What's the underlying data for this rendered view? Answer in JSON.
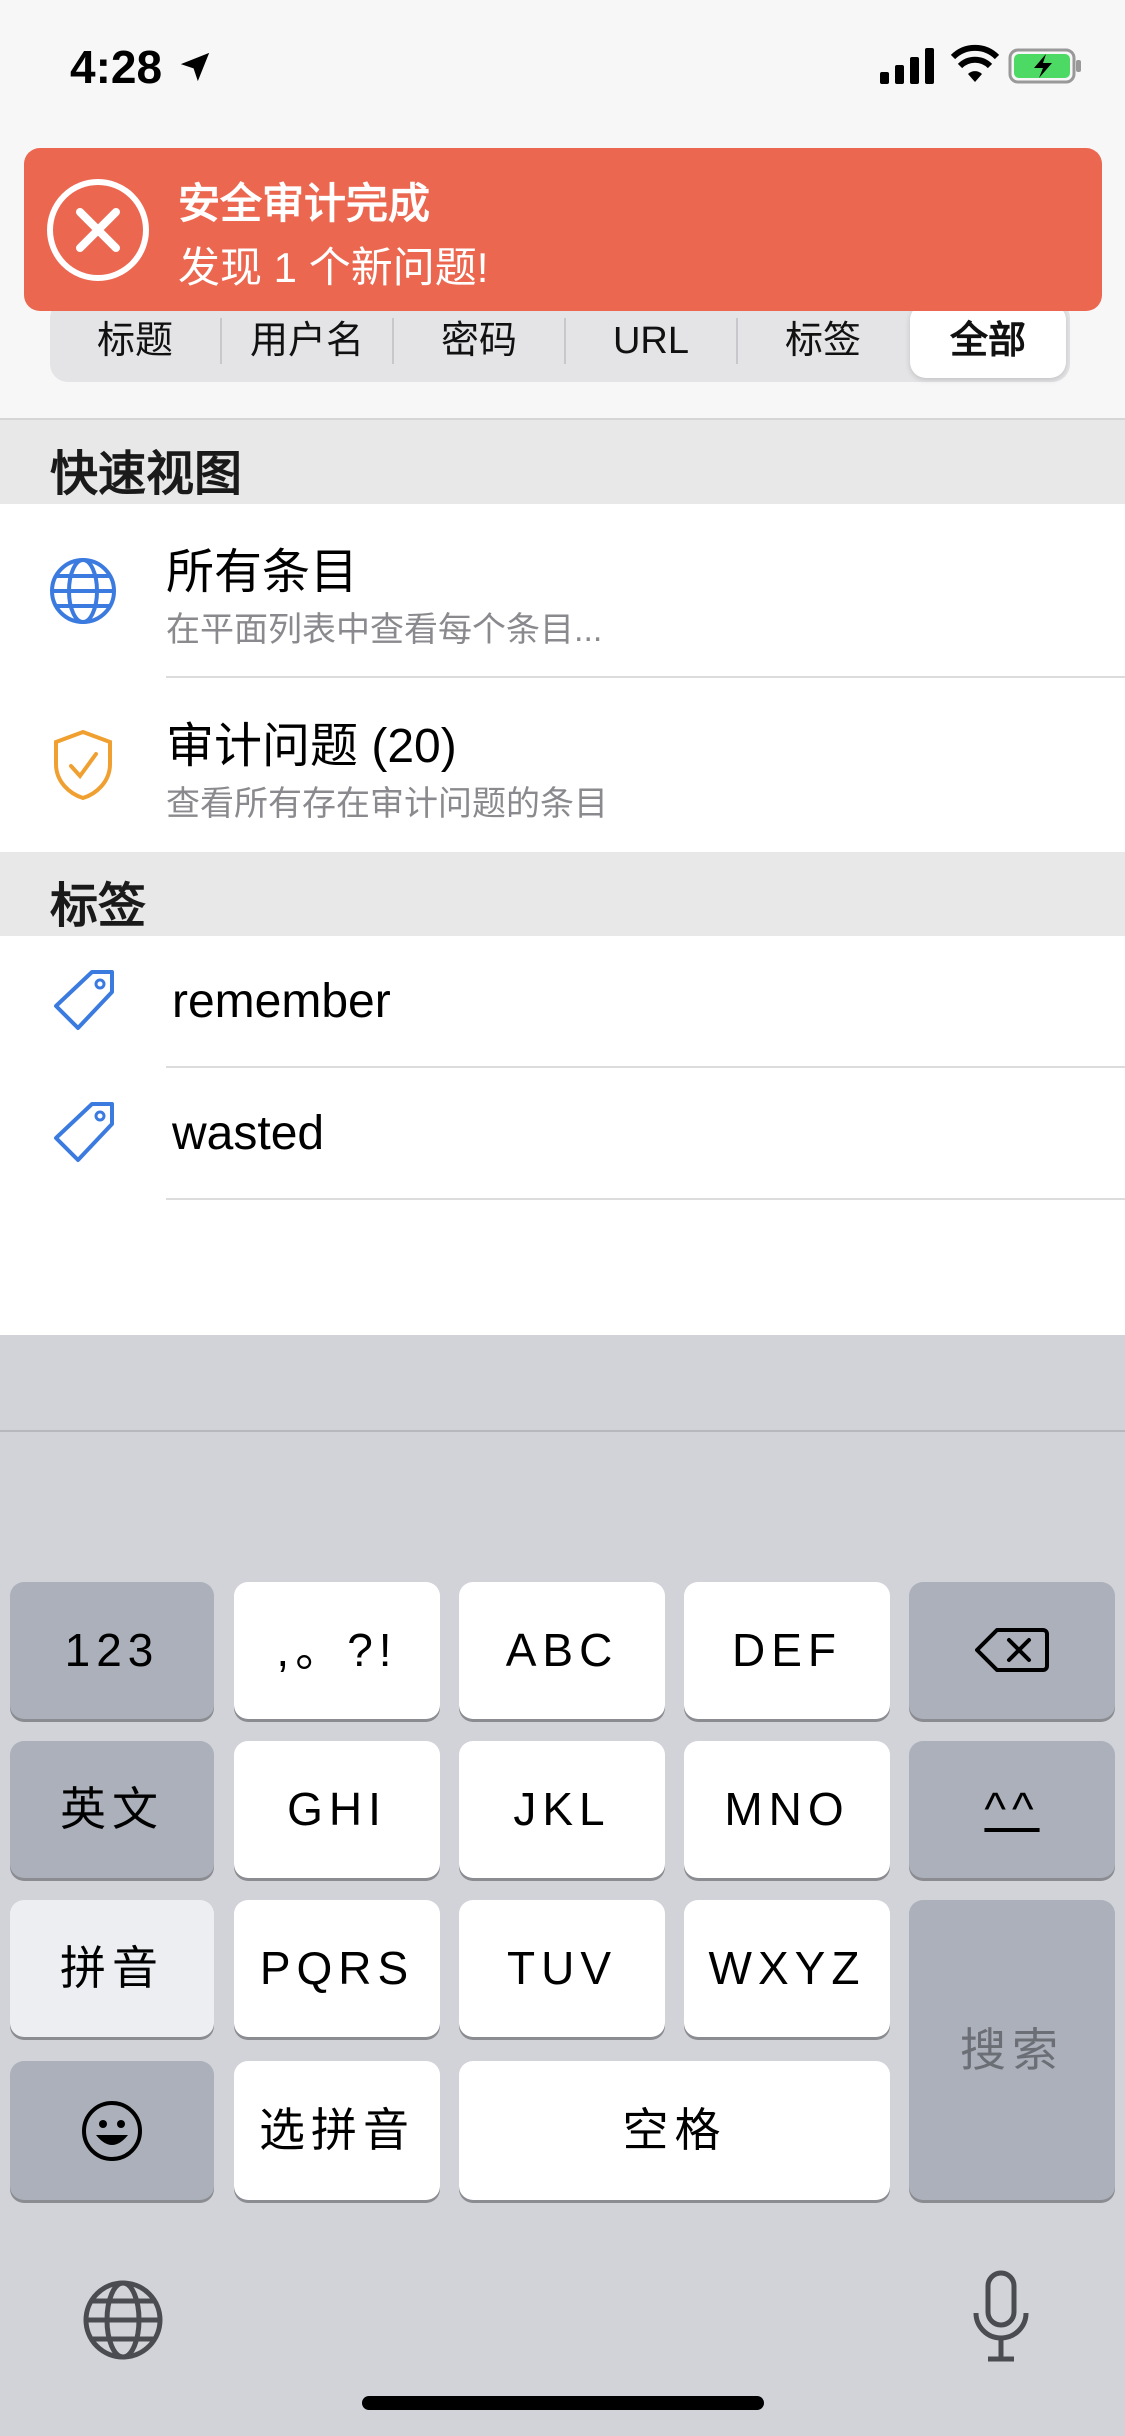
{
  "status_bar": {
    "time": "4:28"
  },
  "banner": {
    "title": "安全审计完成",
    "message": "发现 1 个新问题!"
  },
  "search_scope": {
    "options": [
      "标题",
      "用户名",
      "密码",
      "URL",
      "标签",
      "全部"
    ],
    "selected": "全部"
  },
  "quick_views": {
    "header": "快速视图",
    "items": [
      {
        "title": "所有条目",
        "subtitle": "在平面列表中查看每个条目..."
      },
      {
        "title": "审计问题 (20)",
        "subtitle": "查看所有存在审计问题的条目"
      }
    ]
  },
  "tags": {
    "header": "标签",
    "items": [
      {
        "label": "remember"
      },
      {
        "label": "wasted"
      }
    ]
  },
  "keyboard": {
    "k_123": "123",
    "k_punct": ",。?!",
    "k_abc": "ABC",
    "k_def": "DEF",
    "k_en": "英文",
    "k_ghi": "GHI",
    "k_jkl": "JKL",
    "k_mno": "MNO",
    "k_face": "^^",
    "k_pinyin": "拼音",
    "k_pqrs": "PQRS",
    "k_tuv": "TUV",
    "k_wxyz": "WXYZ",
    "k_search": "搜索",
    "k_select_pinyin": "选拼音",
    "k_space": "空格"
  },
  "colors": {
    "banner": "#ec6750",
    "accent_blue": "#3b7be0",
    "audit_orange": "#f0a030"
  }
}
